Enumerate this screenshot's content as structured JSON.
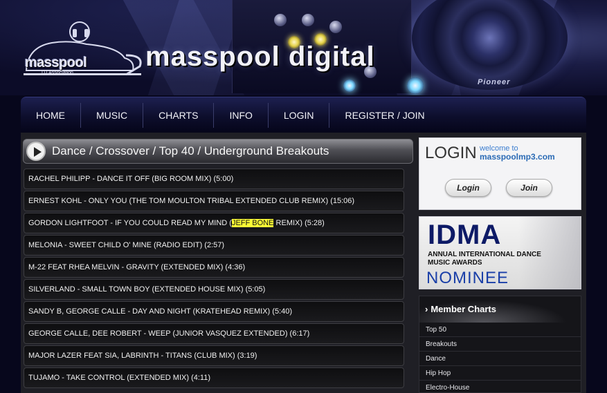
{
  "header": {
    "logo_word": "masspool",
    "logo_sub": "DJ Association",
    "site_title": "masspool digital",
    "brand_mark": "Pioneer"
  },
  "nav": {
    "items": [
      "HOME",
      "MUSIC",
      "CHARTS",
      "INFO",
      "LOGIN",
      "REGISTER / JOIN"
    ]
  },
  "section": {
    "title": "Dance / Crossover / Top 40 / Underground Breakouts"
  },
  "tracks": [
    {
      "text": "RACHEL PHILIPP - DANCE IT OFF (BIG ROOM MIX) (5:00)"
    },
    {
      "text": "ERNEST KOHL - ONLY YOU (THE TOM MOULTON TRIBAL EXTENDED CLUB REMIX) (15:06)"
    },
    {
      "pre": "GORDON LIGHTFOOT - IF YOU COULD READ MY MIND (",
      "highlight": "JEFF BONE",
      "post": " REMIX) (5:28)"
    },
    {
      "text": "MELONIA - SWEET CHILD O' MINE (RADIO EDIT) (2:57)"
    },
    {
      "text": "M-22 FEAT RHEA MELVIN - GRAVITY (EXTENDED MIX) (4:36)"
    },
    {
      "text": "SILVERLAND - SMALL TOWN BOY (EXTENDED HOUSE MIX) (5:05)"
    },
    {
      "text": "SANDY B, GEORGE CALLE - DAY AND NIGHT (KRATEHEAD REMIX) (5:40)"
    },
    {
      "text": "GEORGE CALLE, DEE ROBERT - WEEP (JUNIOR VASQUEZ EXTENDED) (6:17)"
    },
    {
      "text": "MAJOR LAZER FEAT SIA, LABRINTH - TITANS (CLUB MIX) (3:19)"
    },
    {
      "text": "TUJAMO - TAKE CONTROL (EXTENDED MIX) (4:11)"
    }
  ],
  "login_box": {
    "title": "LOGIN",
    "welcome": "welcome to",
    "site": "masspoolmp3.com",
    "login_button": "Login",
    "join_button": "Join"
  },
  "idma": {
    "word": "IDMA",
    "line1": "ANNUAL INTERNATIONAL DANCE",
    "line2": "MUSIC AWARDS",
    "nominee": "NOMINEE"
  },
  "member_charts": {
    "heading": "Member Charts",
    "items": [
      "Top 50",
      "Breakouts",
      "Dance",
      "Hip Hop",
      "Electro-House"
    ]
  },
  "colors": {
    "page_bg": "#07071c",
    "content_bg": "#1f1f25",
    "highlight": "#ffff35",
    "link_blue": "#3c7ed0",
    "idma_navy": "#0d1a66"
  }
}
